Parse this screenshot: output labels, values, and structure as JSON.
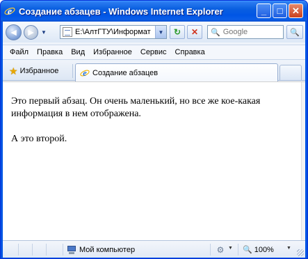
{
  "window": {
    "title": "Создание абзацев - Windows Internet Explorer",
    "minimize_glyph": "_",
    "maximize_glyph": "□",
    "close_glyph": "✕"
  },
  "address_bar": {
    "back_glyph": "◄",
    "forward_glyph": "►",
    "history_arrow": "▼",
    "url": "E:\\АлтГТУ\\Информат",
    "dropdown_glyph": "▼",
    "refresh_glyph": "↻",
    "stop_glyph": "✕"
  },
  "search": {
    "icon": "🔍",
    "placeholder": "Google",
    "button_glyph": "🔍"
  },
  "menu": {
    "items": [
      "Файл",
      "Правка",
      "Вид",
      "Избранное",
      "Сервис",
      "Справка"
    ]
  },
  "tabs": {
    "favorites_label": "Избранное",
    "favorites_icon": "★",
    "active_tab_label": "Создание абзацев"
  },
  "content": {
    "paragraph_1": "Это первый абзац. Он очень маленький, но все же кое-какая информация в нем отображена.",
    "paragraph_2": "А это второй."
  },
  "status": {
    "zone_label": "Мой компьютер",
    "protect_icon": "⚙",
    "dropdown_glyph": "▼",
    "zoom_icon": "🔍",
    "zoom_label": "100%"
  },
  "colors": {
    "titlebar": "#0055e5",
    "ie_icon": "#1e6fd9",
    "accent": "#0831d9"
  }
}
